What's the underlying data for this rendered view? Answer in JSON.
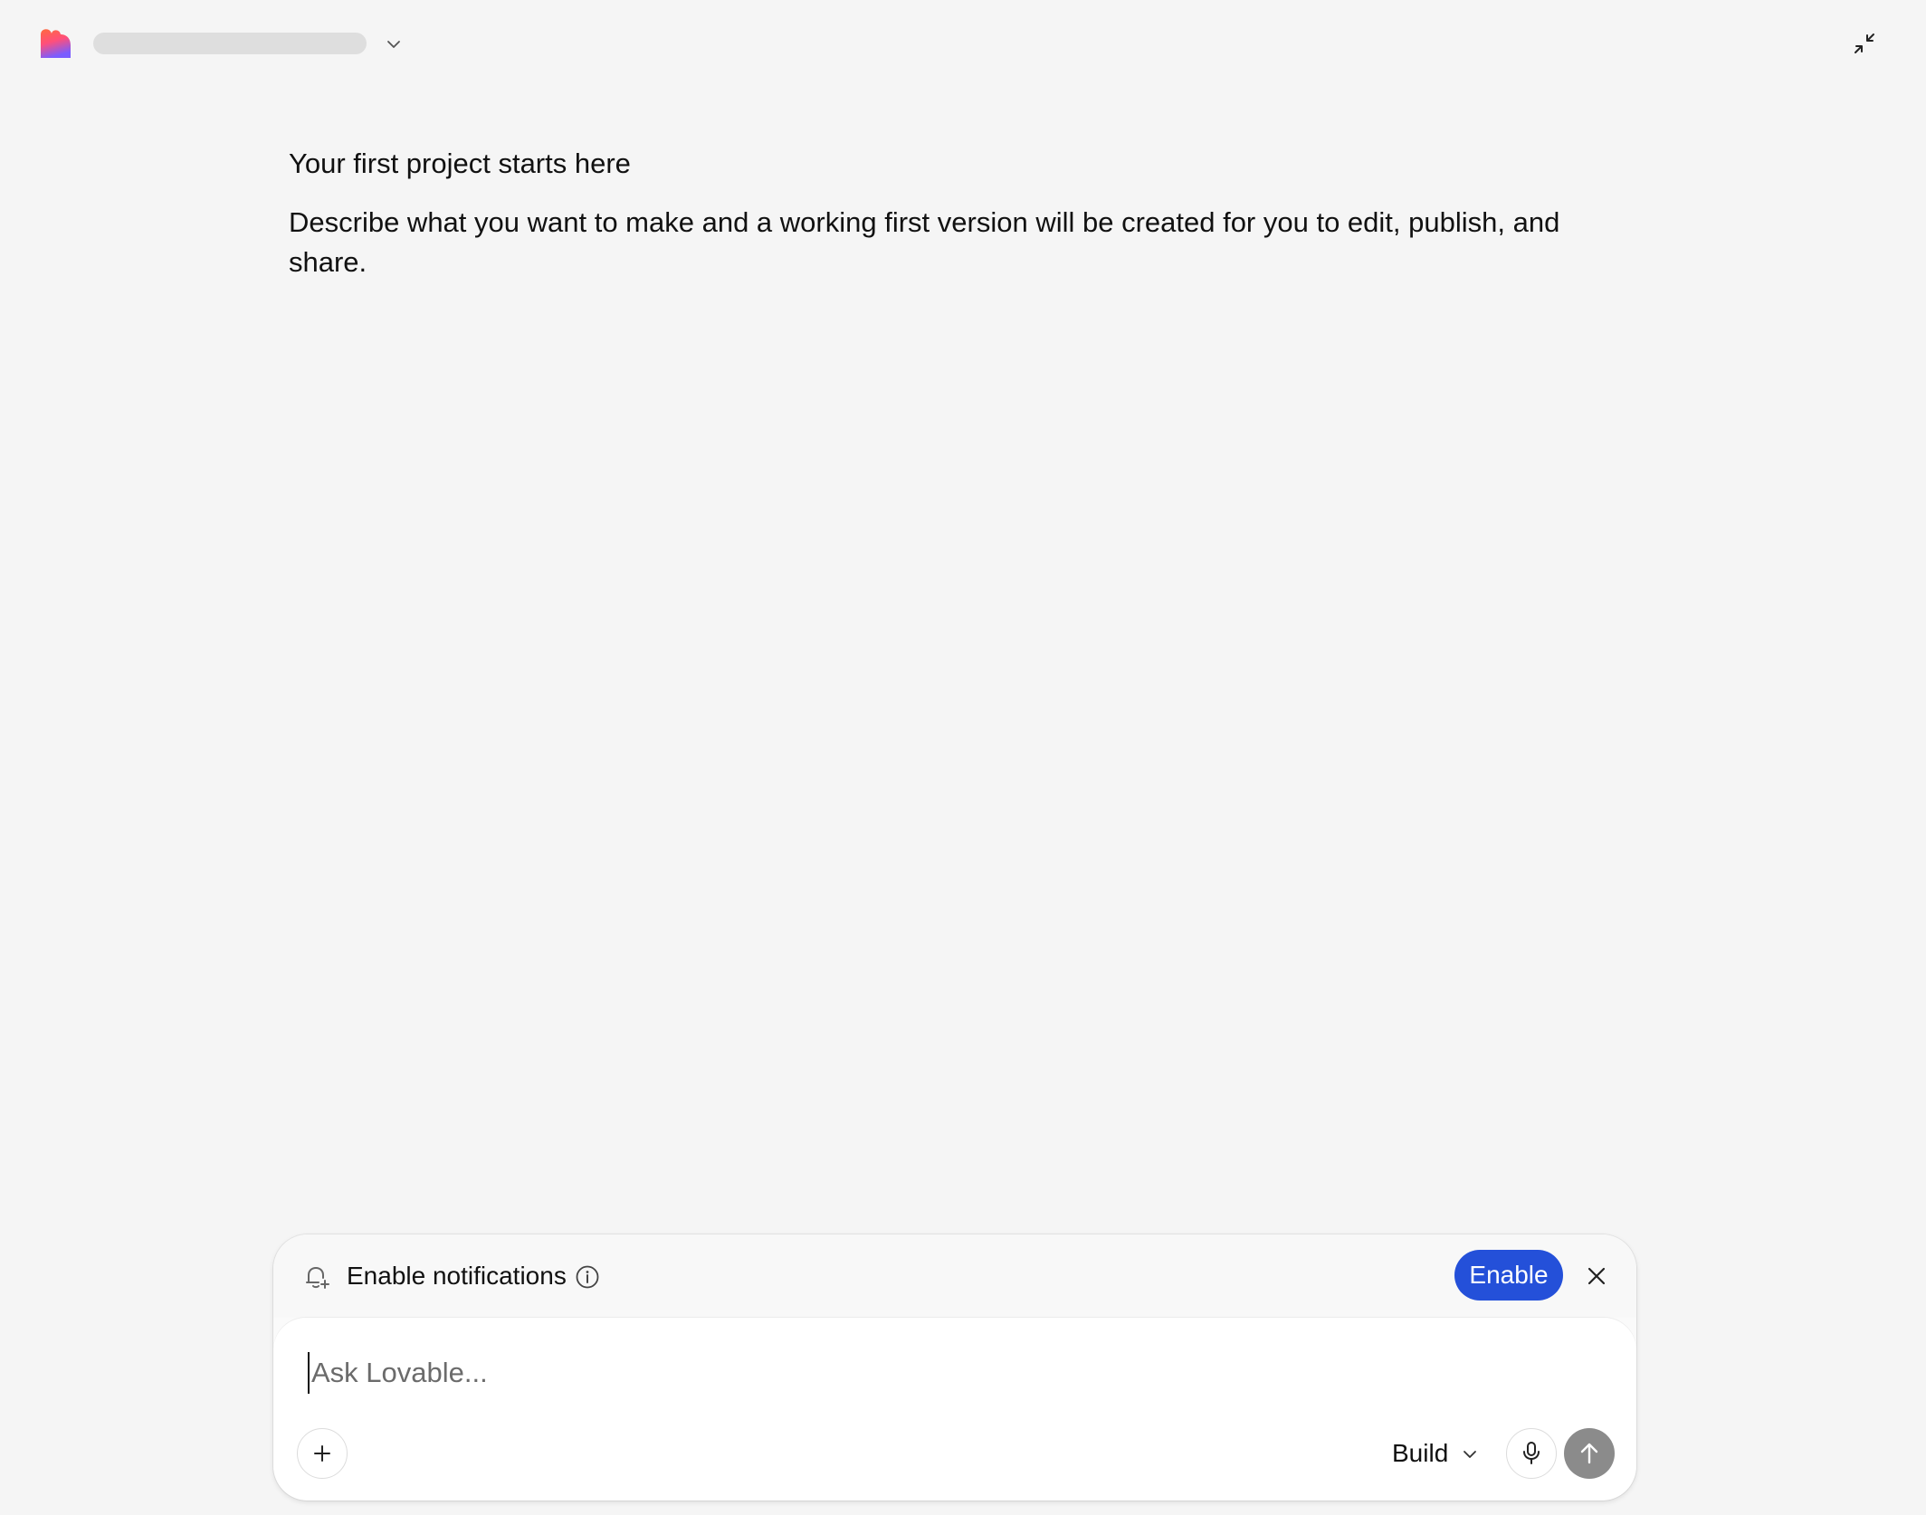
{
  "header": {
    "logo_icon": "lovable-heart-logo",
    "project_menu_icon": "chevron-down-icon",
    "collapse_icon": "minimize-arrows-icon"
  },
  "intro": {
    "title": "Your first project starts here",
    "body": "Describe what you want to make and a working first version will be created for you to edit, publish, and share."
  },
  "notification_bar": {
    "label": "Enable notifications",
    "enable_label": "Enable",
    "accent_color": "#2450d9",
    "icons": [
      "bell-plus-icon",
      "info-icon",
      "close-icon"
    ]
  },
  "composer": {
    "placeholder": "Ask Lovable...",
    "value": "",
    "mode": "Build",
    "icons": [
      "plus-icon",
      "chevron-down-icon",
      "microphone-icon",
      "arrow-up-icon"
    ]
  }
}
